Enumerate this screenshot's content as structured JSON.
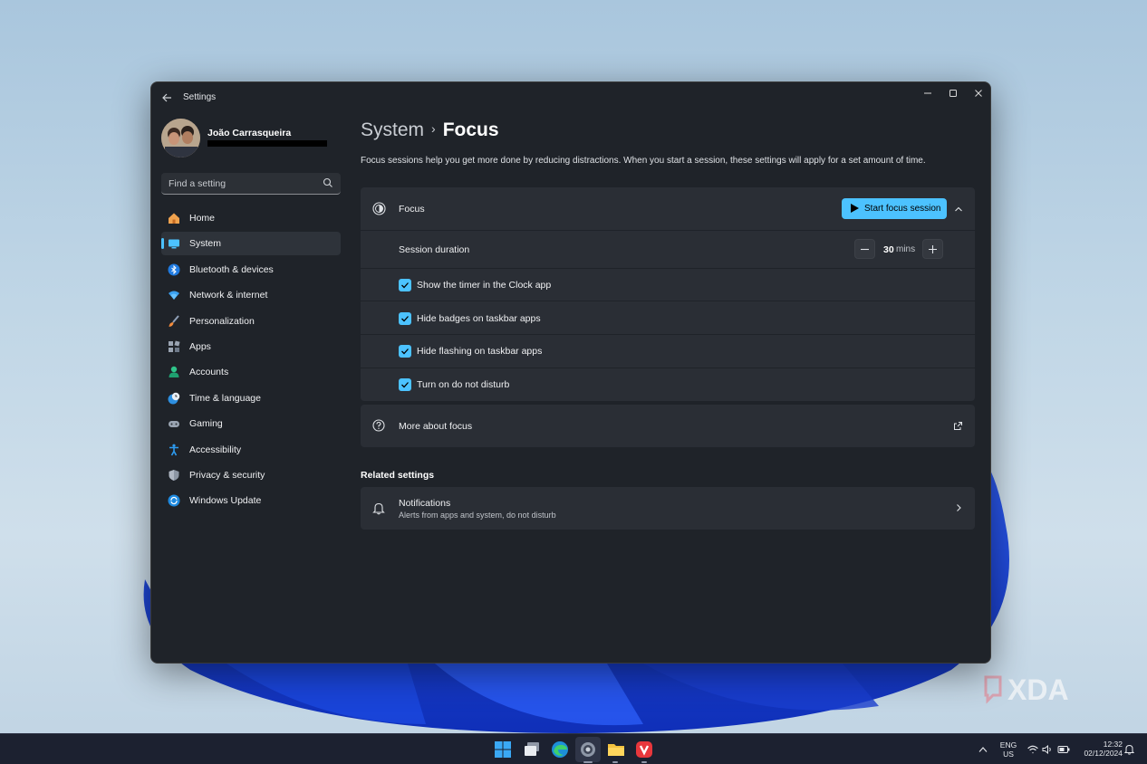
{
  "window": {
    "app_title": "Settings",
    "controls": {
      "minimize_icon": "minimize-icon",
      "maximize_icon": "maximize-icon",
      "close_icon": "close-icon"
    }
  },
  "profile": {
    "name": "João Carrasqueira"
  },
  "search": {
    "placeholder": "Find a setting",
    "value": ""
  },
  "sidebar": {
    "items": [
      {
        "label": "Home",
        "icon": "home-icon"
      },
      {
        "label": "System",
        "icon": "system-icon",
        "active": true
      },
      {
        "label": "Bluetooth & devices",
        "icon": "bluetooth-icon"
      },
      {
        "label": "Network & internet",
        "icon": "wifi-icon"
      },
      {
        "label": "Personalization",
        "icon": "brush-icon"
      },
      {
        "label": "Apps",
        "icon": "apps-icon"
      },
      {
        "label": "Accounts",
        "icon": "accounts-icon"
      },
      {
        "label": "Time & language",
        "icon": "clock-globe-icon"
      },
      {
        "label": "Gaming",
        "icon": "gamepad-icon"
      },
      {
        "label": "Accessibility",
        "icon": "accessibility-icon"
      },
      {
        "label": "Privacy & security",
        "icon": "shield-icon"
      },
      {
        "label": "Windows Update",
        "icon": "update-icon"
      }
    ]
  },
  "breadcrumb": {
    "parent": "System",
    "separator": "›",
    "current": "Focus"
  },
  "description": "Focus sessions help you get more done by reducing distractions. When you start a session, these settings will apply for a set amount of time.",
  "focus_card": {
    "title": "Focus",
    "start_button": "Start focus session",
    "session_duration_label": "Session duration",
    "duration_value": "30",
    "duration_unit": "mins",
    "options": [
      {
        "label": "Show the timer in the Clock app",
        "checked": true
      },
      {
        "label": "Hide badges on taskbar apps",
        "checked": true
      },
      {
        "label": "Hide flashing on taskbar apps",
        "checked": true
      },
      {
        "label": "Turn on do not disturb",
        "checked": true
      }
    ]
  },
  "more_about": {
    "label": "More about focus"
  },
  "related": {
    "title": "Related settings",
    "notifications": {
      "title": "Notifications",
      "subtitle": "Alerts from apps and system, do not disturb"
    }
  },
  "taskbar": {
    "apps": [
      "start-icon",
      "task-view-icon",
      "edge-icon",
      "settings-icon",
      "file-explorer-icon",
      "vivaldi-icon"
    ],
    "lang_line1": "ENG",
    "lang_line2": "US",
    "time": "12:32",
    "date": "02/12/2024"
  },
  "watermark": "XDA",
  "colors": {
    "accent": "#4cc2ff",
    "window_bg": "#1f2329",
    "card_bg": "#2a2e35"
  }
}
